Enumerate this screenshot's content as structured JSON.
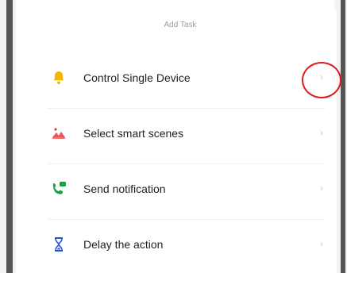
{
  "dialog": {
    "title": "Add Task",
    "items": [
      {
        "icon": "bell-icon",
        "label": "Control Single Device",
        "chevron": "›"
      },
      {
        "icon": "scene-icon",
        "label": "Select smart scenes",
        "chevron": "›"
      },
      {
        "icon": "notification-icon",
        "label": "Send notification",
        "chevron": "›"
      },
      {
        "icon": "hourglass-icon",
        "label": "Delay the action",
        "chevron": "›"
      }
    ]
  },
  "colors": {
    "highlight": "#e01919",
    "bell": "#f4b400",
    "scene": "#e53935",
    "notification": "#16a34a",
    "hourglass": "#2557d6"
  }
}
